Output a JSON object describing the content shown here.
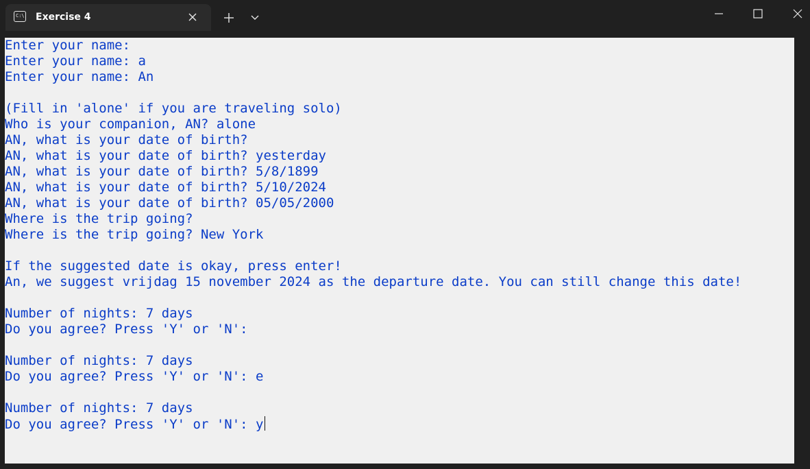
{
  "window": {
    "tab_title": "Exercise 4",
    "tab_icon": "terminal-icon"
  },
  "console": {
    "lines": [
      "Enter your name:",
      "Enter your name: a",
      "Enter your name: An",
      "",
      "(Fill in 'alone' if you are traveling solo)",
      "Who is your companion, AN? alone",
      "AN, what is your date of birth?",
      "AN, what is your date of birth? yesterday",
      "AN, what is your date of birth? 5/8/1899",
      "AN, what is your date of birth? 5/10/2024",
      "AN, what is your date of birth? 05/05/2000",
      "Where is the trip going?",
      "Where is the trip going? New York",
      "",
      "If the suggested date is okay, press enter!",
      "An, we suggest vrijdag 15 november 2024 as the departure date. You can still change this date!",
      "",
      "Number of nights: 7 days",
      "Do you agree? Press 'Y' or 'N':",
      "",
      "Number of nights: 7 days",
      "Do you agree? Press 'Y' or 'N': e",
      "",
      "Number of nights: 7 days",
      "Do you agree? Press 'Y' or 'N': y"
    ]
  },
  "colors": {
    "text": "#0a3cc8",
    "background": "#f0f0f0",
    "titlebar": "#202020"
  }
}
